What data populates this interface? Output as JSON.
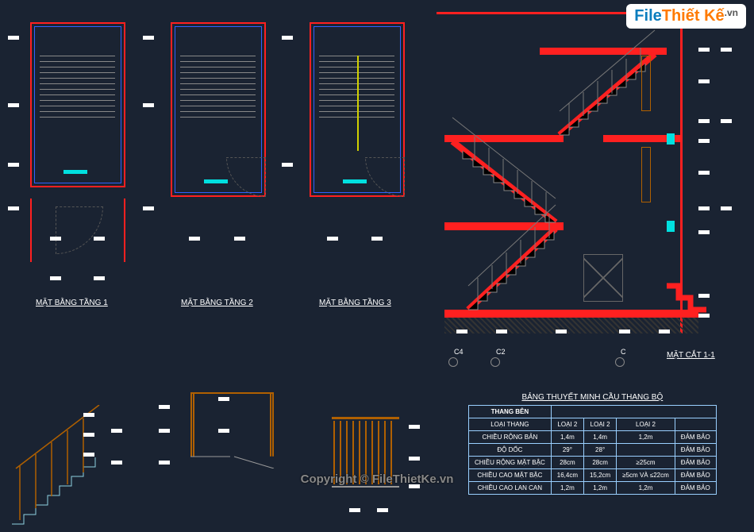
{
  "watermark": {
    "logo_part1": "File",
    "logo_part2": "Thiết Kế",
    "logo_ext": ".vn",
    "center_text": "Copyright © FileThietKe.vn"
  },
  "plan_titles": {
    "floor1": "MẶT BẰNG TẦNG 1",
    "floor2": "MẶT BẰNG TẦNG 2",
    "floor3": "MẶT BẰNG TẦNG 3",
    "section": "MẶT CẮT 1-1"
  },
  "axis_labels": {
    "c4": "C4",
    "c2": "C2",
    "c": "C"
  },
  "spec_table": {
    "title": "BẢNG THUYẾT MINH CẦU THANG BỘ",
    "header": [
      "THANG BÊN",
      "",
      "",
      "",
      ""
    ],
    "rows": [
      [
        "LOẠI THANG",
        "LOẠI 2",
        "LOẠI 2",
        "LOẠI 2",
        ""
      ],
      [
        "CHIỀU RỘNG BẢN",
        "1,4m",
        "1,4m",
        "1,2m",
        "ĐẢM BẢO"
      ],
      [
        "ĐỘ DỐC",
        "29°",
        "28°",
        "",
        "ĐẢM BẢO"
      ],
      [
        "CHIỀU RỘNG MẶT BẬC",
        "28cm",
        "28cm",
        "≥25cm",
        "ĐẢM BẢO"
      ],
      [
        "CHIỀU CAO MẶT BẬC",
        "16,4cm",
        "15,2cm",
        "≥5cm VÀ ≤22cm",
        "ĐẢM BẢO"
      ],
      [
        "CHIỀU CAO LAN CAN",
        "1,2m",
        "1,2m",
        "1,2m",
        "ĐẢM BẢO"
      ]
    ]
  }
}
